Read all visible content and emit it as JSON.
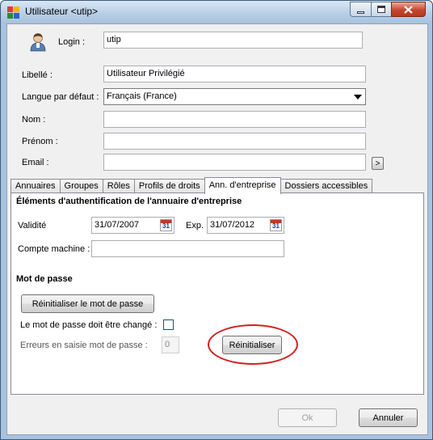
{
  "window": {
    "title": "Utilisateur <utip>"
  },
  "icons": {
    "app": "app-icon",
    "user": "user-avatar-icon",
    "calendar": "calendar-icon"
  },
  "form": {
    "login_label": "Login :",
    "login_value": "utip",
    "libelle_label": "Libellé :",
    "libelle_value": "Utilisateur Privilégié",
    "langue_label": "Langue par défaut :",
    "langue_value": "Français (France)",
    "nom_label": "Nom :",
    "nom_value": "",
    "prenom_label": "Prénom :",
    "prenom_value": "",
    "email_label": "Email :",
    "email_value": "",
    "email_button": ">"
  },
  "tabs": [
    {
      "label": "Annuaires",
      "active": false
    },
    {
      "label": "Groupes",
      "active": false
    },
    {
      "label": "Rôles",
      "active": false
    },
    {
      "label": "Profils de droits",
      "active": false
    },
    {
      "label": "Ann. d'entreprise",
      "active": true
    },
    {
      "label": "Dossiers accessibles",
      "active": false
    }
  ],
  "panel": {
    "auth_title": "Éléments d'authentification de l'annuaire d'entreprise",
    "validite_label": "Validité",
    "validite_value": "31/07/2007",
    "exp_label": "Exp.",
    "exp_value": "31/07/2012",
    "calendar_day": "31",
    "compte_label": "Compte machine :",
    "compte_value": "",
    "mdp_title": "Mot de passe",
    "reset_pwd_button": "Réinitialiser le mot de passe",
    "must_change_label": "Le mot de passe doit être changé :",
    "must_change_checked": false,
    "errors_label": "Erreurs en saisie mot de passe :",
    "errors_value": "0",
    "reset_button": "Réinitialiser"
  },
  "footer": {
    "ok": "Ok",
    "cancel": "Annuler"
  },
  "colors": {
    "highlight_ellipse": "#d42020",
    "titlebar": "#b9cfe6",
    "close_button": "#c9452f"
  }
}
